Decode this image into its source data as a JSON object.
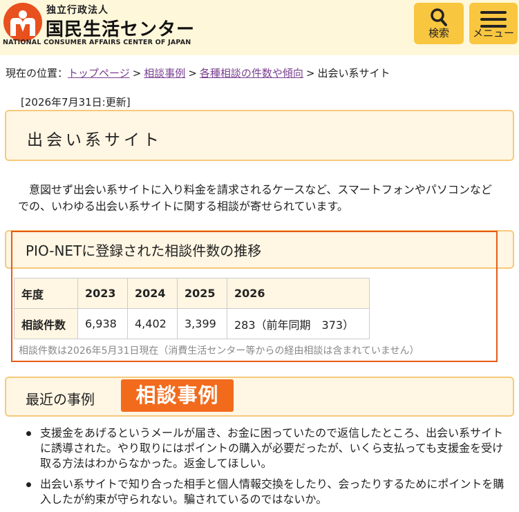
{
  "header": {
    "org_sub": "独立行政法人",
    "org_name": "国民生活センター",
    "org_en": "NATIONAL CONSUMER AFFAIRS CENTER OF JAPAN",
    "search_label": "検索",
    "menu_label": "メニュー",
    "brand_color": "#e8501d",
    "button_color": "#f9c640"
  },
  "breadcrumb": {
    "prefix": "現在の位置：",
    "items": [
      {
        "label": "トップページ",
        "link": true
      },
      {
        "label": "相談事例",
        "link": true
      },
      {
        "label": "各種相談の件数や傾向",
        "link": true
      },
      {
        "label": "出会い系サイト",
        "link": false
      }
    ],
    "separator": ">"
  },
  "updated": "[2026年7月31日:更新]",
  "page_title": "出会い系サイト",
  "intro": "意図せず出会い系サイトに入り料金を請求されるケースなど、スマートフォンやパソコンなどでの、いわゆる出会い系サイトに関する相談が寄せられています。",
  "stats": {
    "heading": "PIO-NETに登録された相談件数の推移",
    "row_year_label": "年度",
    "row_count_label": "相談件数",
    "years": [
      "2023",
      "2024",
      "2025",
      "2026"
    ],
    "counts": [
      "6,938",
      "4,402",
      "3,399",
      "283（前年同期　373）"
    ],
    "note": "相談件数は2026年5月31日現在（消費生活センター等からの経由相談は含まれていません）"
  },
  "recent": {
    "heading": "最近の事例",
    "tag": "相談事例",
    "cases": [
      "支援金をあげるというメールが届き、お金に困っていたので返信したところ、出会い系サイトに誘導された。やり取りにはポイントの購入が必要だったが、いくら支払っても支援金を受け取る方法はわからなかった。返金してほしい。",
      "出会い系サイトで知り合った相手と個人情報交換をしたり、会ったりするためにポイントを購入したが約束が守られない。騙されているのではないか。"
    ]
  }
}
